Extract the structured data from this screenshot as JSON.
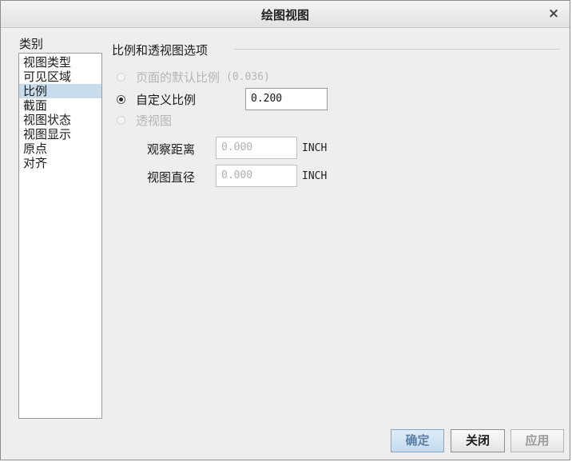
{
  "dialog": {
    "title": "绘图视图",
    "close_symbol": "×"
  },
  "category": {
    "label": "类别",
    "items": [
      "视图类型",
      "可见区域",
      "比例",
      "截面",
      "视图状态",
      "视图显示",
      "原点",
      "对齐"
    ],
    "selected_index": 2
  },
  "scale_group": {
    "title": "比例和透视图选项",
    "options": [
      {
        "label": "页面的默认比例",
        "value": "(0.036)",
        "enabled": false,
        "checked": false
      },
      {
        "label": "自定义比例",
        "value": "0.200",
        "enabled": true,
        "checked": true
      },
      {
        "label": "透视图",
        "enabled": false,
        "checked": false
      }
    ],
    "viewing_distance": {
      "label": "观察距离",
      "value": "0.000",
      "unit": "INCH"
    },
    "view_diameter": {
      "label": "视图直径",
      "value": "0.000",
      "unit": "INCH"
    }
  },
  "buttons": {
    "ok": "确定",
    "close": "关闭",
    "apply": "应用"
  }
}
